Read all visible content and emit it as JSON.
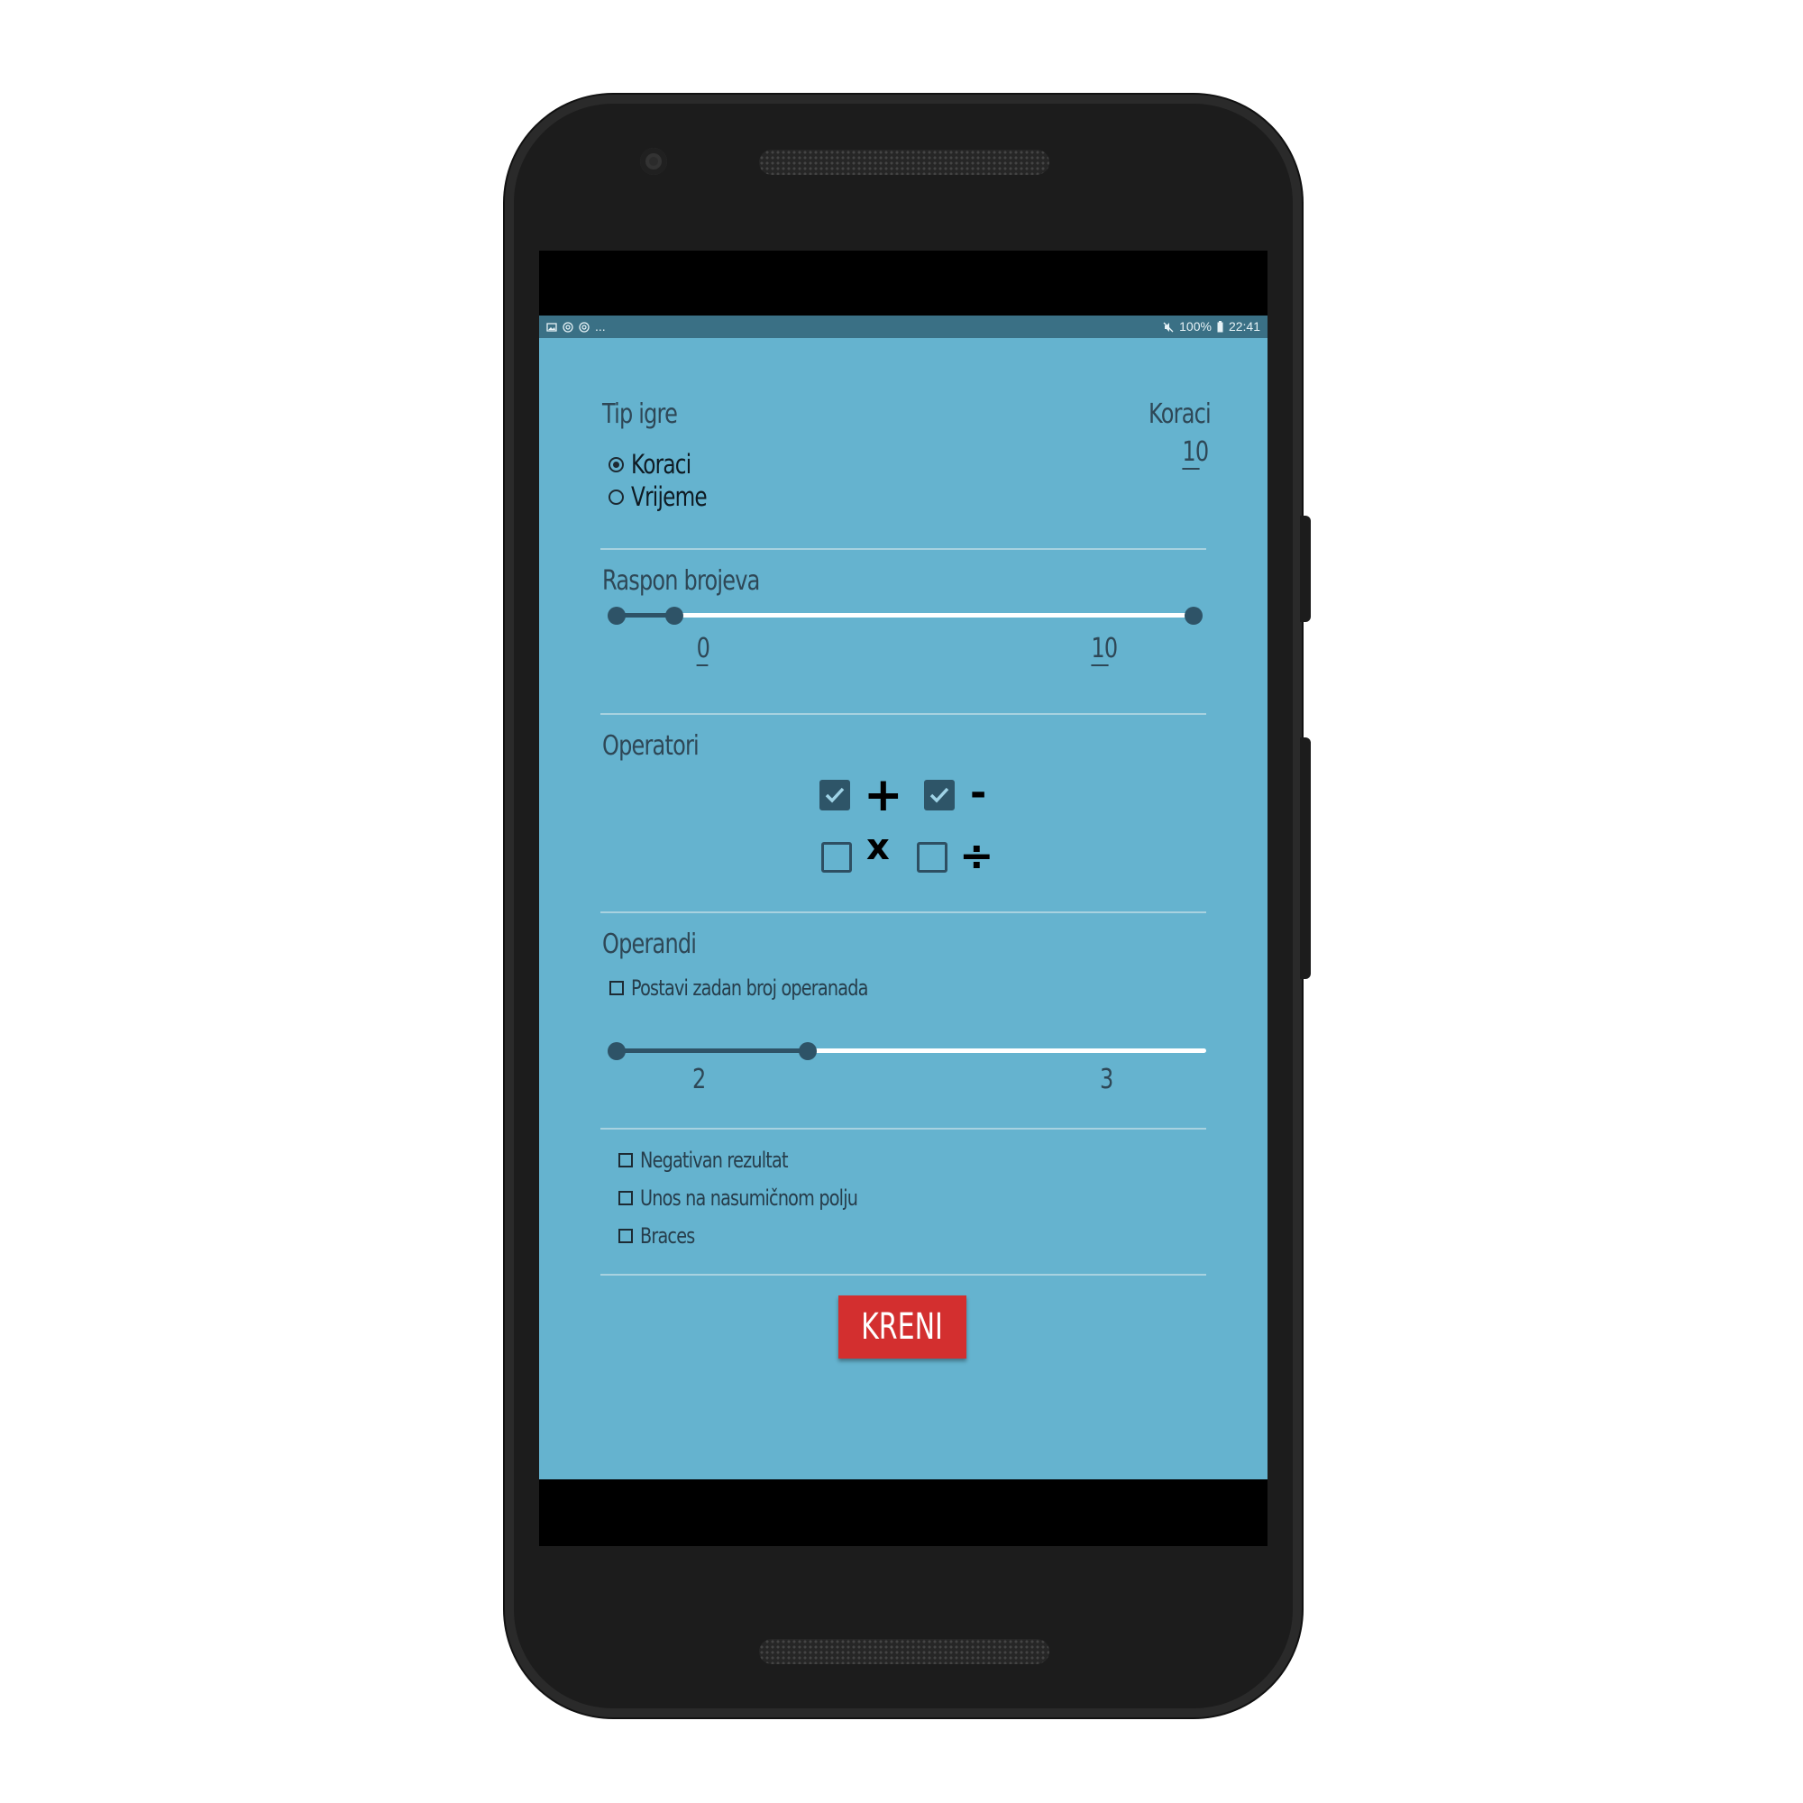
{
  "status_bar": {
    "left_more": "...",
    "battery": "100%",
    "time": "22:41"
  },
  "game_type": {
    "title": "Tip igre",
    "options": [
      {
        "label": "Koraci",
        "selected": true
      },
      {
        "label": "Vrijeme",
        "selected": false
      }
    ],
    "value_label": "Koraci",
    "value": "10"
  },
  "number_range": {
    "title": "Raspon brojeva",
    "min_value": "0",
    "max_value": "10"
  },
  "operators": {
    "title": "Operatori",
    "items": [
      {
        "symbol": "+",
        "checked": true
      },
      {
        "symbol": "-",
        "checked": true
      },
      {
        "symbol": "x",
        "checked": false
      },
      {
        "symbol": "÷",
        "checked": false
      }
    ]
  },
  "operands": {
    "title": "Operandi",
    "fixed_count_label": "Postavi zadan broj operanada",
    "fixed_count_checked": false,
    "min_value": "2",
    "max_value": "3"
  },
  "options": [
    {
      "label": "Negativan rezultat",
      "checked": false
    },
    {
      "label": "Unos na nasumičnom polju",
      "checked": false
    },
    {
      "label": "Braces",
      "checked": false
    }
  ],
  "start_button": "KRENI",
  "colors": {
    "screen_background": "#65b3cf",
    "status_bar": "#3a7085",
    "accent_dark": "#2e5367",
    "start_button": "#d32f2f"
  }
}
